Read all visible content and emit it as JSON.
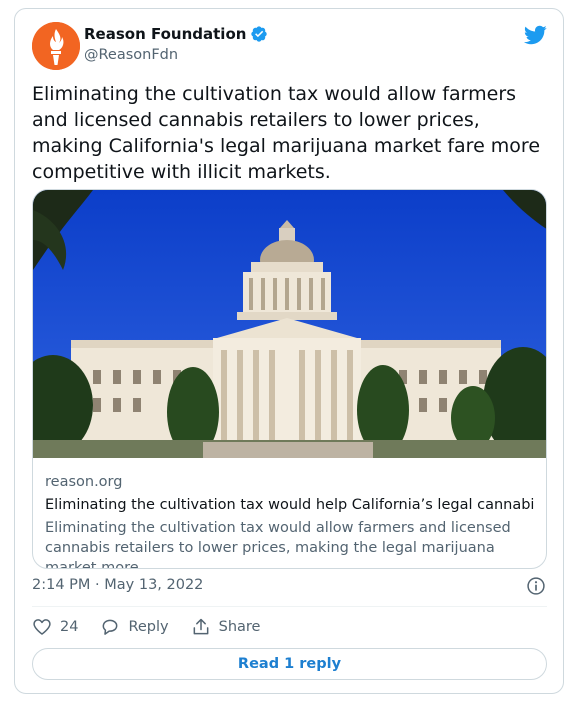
{
  "author": {
    "name": "Reason Foundation",
    "handle": "@ReasonFdn",
    "verified": true,
    "avatar_icon": "torch-icon",
    "avatar_color": "#f26522"
  },
  "tweet": {
    "text": "Eliminating the cultivation tax would allow farmers and licensed cannabis retailers to lower prices, making California's legal marijuana market fare more competitive with illicit markets.",
    "timestamp": "2:14 PM · May 13, 2022"
  },
  "link_card": {
    "domain": "reason.org",
    "title": "Eliminating the cultivation tax would help California’s legal cannabis ind...",
    "description": "Eliminating the cultivation tax would allow farmers and licensed cannabis retailers to lower prices, making the legal marijuana market more ..."
  },
  "actions": {
    "like_count": "24",
    "reply_label": "Reply",
    "share_label": "Share",
    "read_replies_label": "Read 1 reply"
  },
  "colors": {
    "twitter_blue": "#1d9bf0",
    "link_blue": "#1d7fd0",
    "muted_text": "#536471",
    "border": "#cfd9de"
  }
}
